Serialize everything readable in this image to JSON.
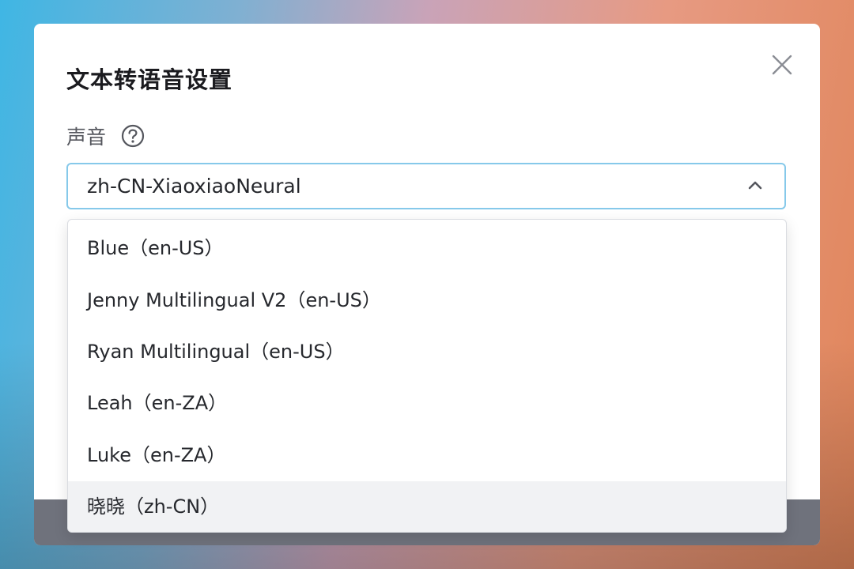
{
  "dialog": {
    "title": "文本转语音设置",
    "close_icon": "close-icon"
  },
  "voice_field": {
    "label": "声音",
    "help_icon": "question-circle-icon",
    "selected_value": "zh-CN-XiaoxiaoNeural",
    "chevron_icon": "chevron-up-icon",
    "focus_color": "#86c9ea"
  },
  "dropdown": {
    "options": [
      {
        "label": "Blue（en-US）"
      },
      {
        "label": "Jenny Multilingual V2（en-US）"
      },
      {
        "label": "Ryan Multilingual（en-US）"
      },
      {
        "label": "Leah（en-ZA）"
      },
      {
        "label": "Luke（en-ZA）"
      },
      {
        "label": "晓晓（zh-CN）"
      }
    ],
    "highlighted_index": 5,
    "highlight_color": "#f1f2f4"
  }
}
